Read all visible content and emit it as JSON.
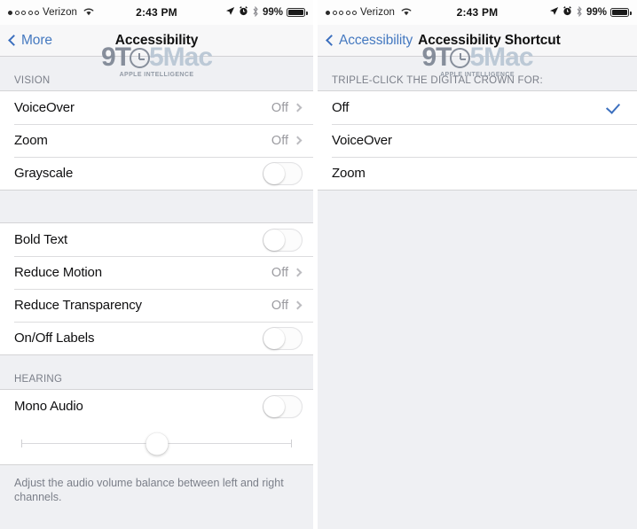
{
  "statusbar": {
    "carrier": "Verizon",
    "signal_dots_total": 5,
    "signal_dots_filled": 1,
    "wifi_icon": "wifi-icon",
    "time": "2:43 PM",
    "location_icon": "location-arrow-icon",
    "alarm_icon": "alarm-clock-icon",
    "bluetooth_icon": "bluetooth-icon",
    "battery_percent": "99%",
    "battery_icon": "battery-full-icon"
  },
  "watermark": {
    "part1": "9T",
    "clock_icon": "clock-icon",
    "part2": "5Mac",
    "subtitle": "APPLE INTELLIGENCE"
  },
  "colors": {
    "accent_blue": "#3b6fbe",
    "toggle_on_green": "#4cd964",
    "group_background": "#eff0f3",
    "row_background": "#ffffff",
    "secondary_text": "#9b9ba0"
  },
  "left_screen": {
    "nav": {
      "back_label": "More",
      "back_icon": "chevron-left-icon",
      "title": "Accessibility"
    },
    "sections": [
      {
        "header": "VISION",
        "rows": [
          {
            "label": "VoiceOver",
            "value": "Off",
            "accessory": "chevron"
          },
          {
            "label": "Zoom",
            "value": "Off",
            "accessory": "chevron"
          },
          {
            "label": "Grayscale",
            "value": "",
            "accessory": "toggle",
            "toggle_state": "off"
          }
        ]
      },
      {
        "header": "",
        "rows": [
          {
            "label": "Bold Text",
            "value": "",
            "accessory": "toggle",
            "toggle_state": "off"
          },
          {
            "label": "Reduce Motion",
            "value": "Off",
            "accessory": "chevron"
          },
          {
            "label": "Reduce Transparency",
            "value": "Off",
            "accessory": "chevron"
          },
          {
            "label": "On/Off Labels",
            "value": "",
            "accessory": "toggle",
            "toggle_state": "off"
          }
        ]
      },
      {
        "header": "HEARING",
        "rows": [
          {
            "label": "Mono Audio",
            "value": "",
            "accessory": "toggle",
            "toggle_state": "off"
          }
        ]
      }
    ],
    "balance_slider": {
      "name": "audio-balance-slider",
      "value_percent": 50,
      "left_label": "",
      "right_label": ""
    },
    "footnote": "Adjust the audio volume balance between left and right channels."
  },
  "right_screen": {
    "nav": {
      "back_label": "Accessibility",
      "back_icon": "chevron-left-icon",
      "title": "Accessibility Shortcut"
    },
    "section_header": "TRIPLE-CLICK THE DIGITAL CROWN FOR:",
    "options": [
      {
        "label": "Off",
        "selected": true
      },
      {
        "label": "VoiceOver",
        "selected": false
      },
      {
        "label": "Zoom",
        "selected": false
      }
    ]
  }
}
